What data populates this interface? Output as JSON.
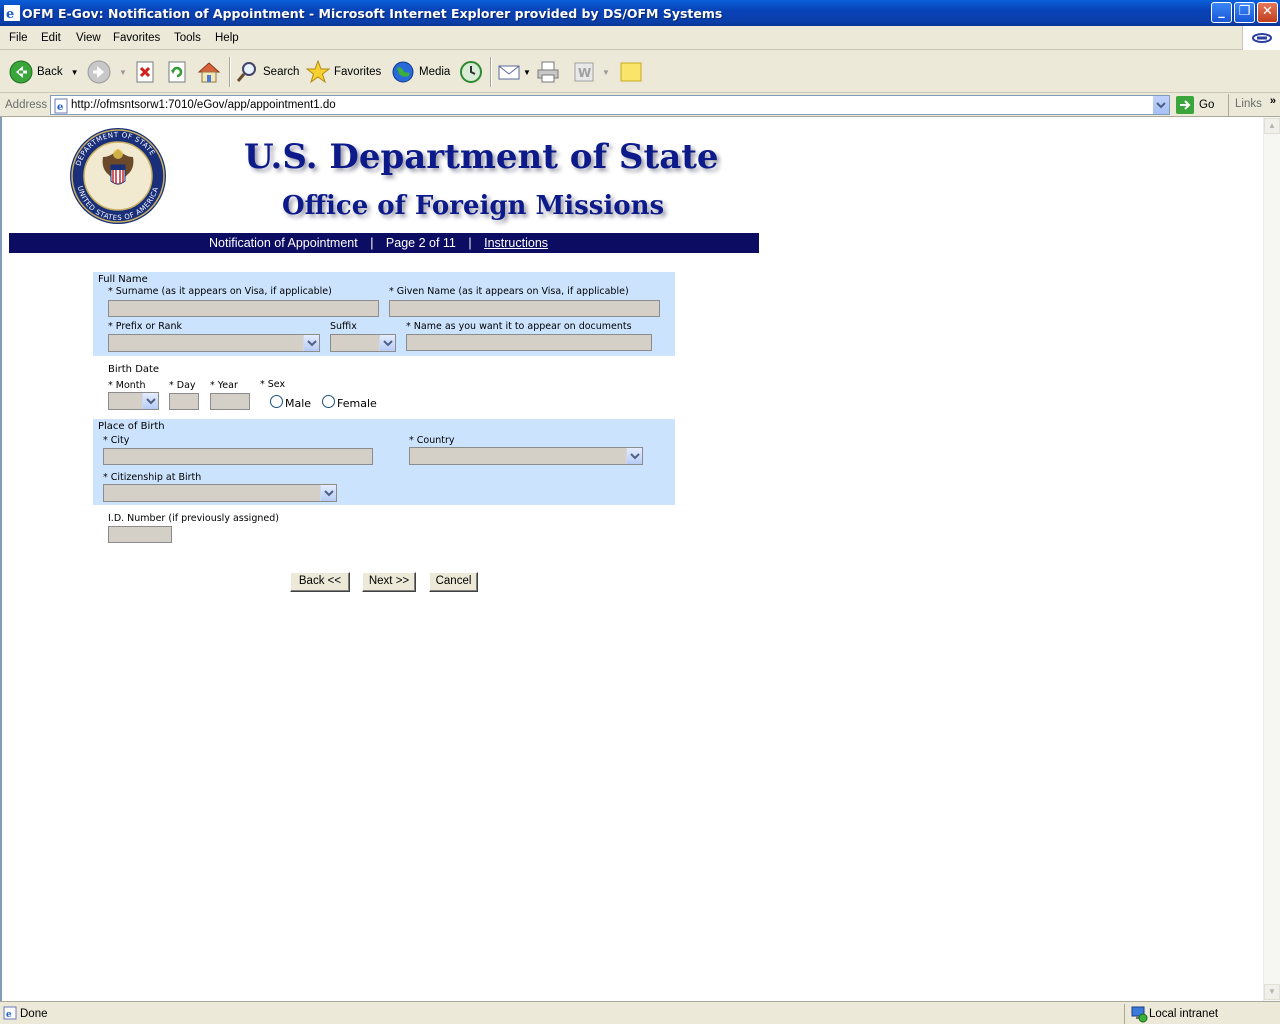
{
  "window": {
    "title": "OFM E-Gov: Notification of Appointment - Microsoft Internet Explorer provided by DS/OFM Systems"
  },
  "menu": [
    "File",
    "Edit",
    "View",
    "Favorites",
    "Tools",
    "Help"
  ],
  "toolbar": {
    "back": "Back",
    "search": "Search",
    "favorites": "Favorites",
    "media": "Media"
  },
  "address": {
    "label": "Address",
    "url": "http://ofmsntsorw1:7010/eGov/app/appointment1.do",
    "go": "Go",
    "links": "Links"
  },
  "page": {
    "header_title": "U.S. Department of State",
    "header_subtitle": "Office of Foreign Missions",
    "seal_text": "DEPARTMENT OF STATE · UNITED STATES OF AMERICA",
    "nav": {
      "form_title": "Notification of Appointment",
      "page_info": "Page 2 of 11",
      "instructions": "Instructions"
    },
    "full_name": {
      "section": "Full Name",
      "surname_label": "* Surname (as it appears on Visa, if applicable)",
      "given_label": "* Given Name (as it appears on Visa, if applicable)",
      "prefix_label": "* Prefix or Rank",
      "suffix_label": "Suffix",
      "doc_name_label": "* Name as you want it to appear on documents"
    },
    "birth_date": {
      "section": "Birth Date",
      "month_label": "* Month",
      "day_label": "* Day",
      "year_label": "* Year",
      "sex_label": "* Sex",
      "male": "Male",
      "female": "Female"
    },
    "place_of_birth": {
      "section": "Place of Birth",
      "city_label": "* City",
      "country_label": "* Country",
      "citizenship_label": "* Citizenship at Birth"
    },
    "id_number": {
      "label": "I.D. Number (if previously assigned)"
    },
    "buttons": {
      "back": "Back <<",
      "next": "Next >>",
      "cancel": "Cancel"
    }
  },
  "status": {
    "text": "Done",
    "zone": "Local intranet"
  }
}
